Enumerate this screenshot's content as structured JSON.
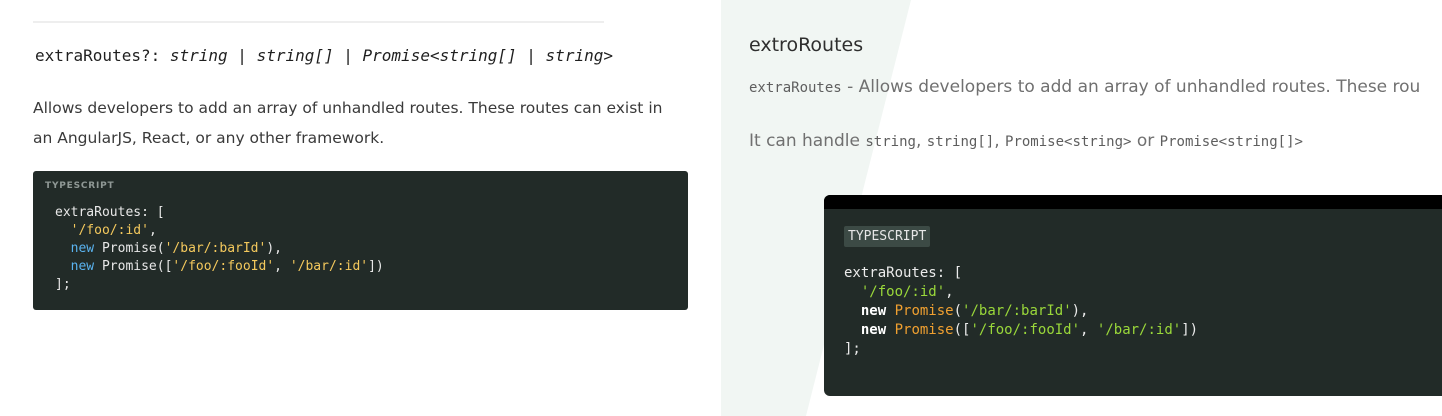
{
  "left": {
    "signature": {
      "name": "extraRoutes?:",
      "types": " string | string[] | Promise<string[] | string>"
    },
    "description": "Allows developers to add an array of unhandled routes. These routes can exist in an AngularJS, React, or any other framework.",
    "code_block": {
      "language": "TYPESCRIPT",
      "lines": {
        "l1": "extraRoutes: [",
        "l2_str": "'/foo/:id'",
        "l3_kw": "new",
        "l3_fn": " Promise(",
        "l3_str": "'/bar/:barId'",
        "l3_end": "),",
        "l4_kw": "new",
        "l4_fn": " Promise([",
        "l4_str1": "'/foo/:fooId'",
        "l4_str2": "'/bar/:id'",
        "l4_end": "])",
        "l5": "];"
      }
    }
  },
  "right": {
    "title": "extroRoutes",
    "desc_code": "extraRoutes",
    "desc_text": " - Allows developers to add an array of unhandled routes. These rou",
    "handle_prefix": "It can handle ",
    "handle_t1": "string",
    "handle_t2": "string[]",
    "handle_t3": "Promise<string>",
    "handle_or": " or ",
    "handle_t4": "Promise<string[]>",
    "code_block": {
      "language": "TYPESCRIPT",
      "lines": {
        "l1": "extraRoutes: [",
        "l2_str": "'/foo/:id'",
        "l3_kw": "new",
        "l3_fn": "Promise",
        "l3_str": "'/bar/:barId'",
        "l3_end": "),",
        "l4_kw": "new",
        "l4_fn": "Promise",
        "l4_str1": "'/foo/:fooId'",
        "l4_str2": "'/bar/:id'",
        "l4_end": "])",
        "l5": "];"
      }
    }
  },
  "colors": {
    "code_bg": "#222b28",
    "left_string": "#f4c95d",
    "left_keyword": "#5ab3f0",
    "right_string": "#9ad83a",
    "right_function": "#f0a030",
    "right_bg": "#f1f6f3"
  }
}
